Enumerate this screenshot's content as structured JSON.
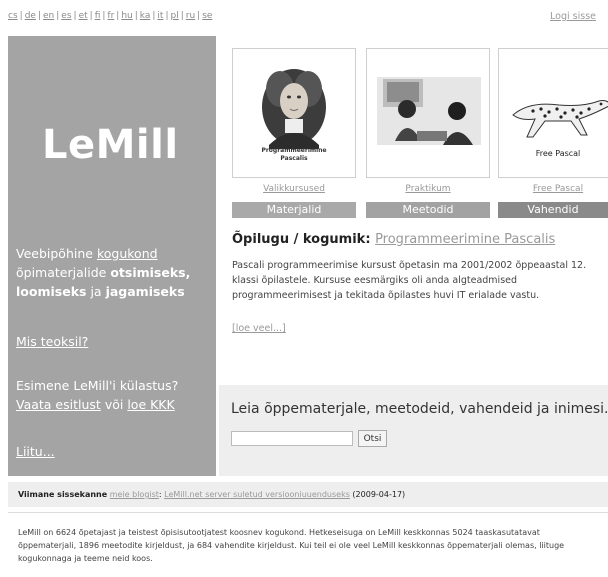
{
  "languages": [
    "cs",
    "de",
    "en",
    "es",
    "et",
    "fi",
    "fr",
    "hu",
    "ka",
    "it",
    "pl",
    "ru",
    "se"
  ],
  "login_label": "Logi sisse",
  "logo": "LeMill",
  "sidebar": {
    "intro_prefix": "Veebipõhine",
    "intro_link": "kogukond",
    "intro_mid": "õpimaterjalide",
    "intro_b1": "otsimiseks,",
    "intro_b2": "loomiseks",
    "intro_mid2": "ja",
    "intro_b3": "jagamiseks",
    "mis_teoksil": "Mis teoksil?",
    "first_visit": "Esimene LeMill'i külastus?",
    "vaata": "Vaata esitlust",
    "voi": "või",
    "loe_kkk": "loe KKK",
    "liitu": "Liitu..."
  },
  "cards": [
    {
      "img_label": "Programmeerimine Pascalis",
      "caption": "Valikkursused",
      "category": "Materjalid",
      "cat_color": "#a9a9a9"
    },
    {
      "img_label": "",
      "caption": "Praktikum",
      "category": "Meetodid",
      "cat_color": "#a2a2a2"
    },
    {
      "img_label": "Free Pascal",
      "caption": "Free Pascal",
      "category": "Vahendid",
      "cat_color": "#8a8a8a"
    }
  ],
  "feature": {
    "label": "Õpilugu / kogumik:",
    "link": "Programmeerimine Pascalis",
    "description": "Pascali programmeerimise kursust õpetasin ma 2001/2002 õppeaastal 12. klassi õpilastele. Kursuse eesmärgiks oli anda algteadmised programmeerimisest ja tekitada õpilastes huvi IT erialade vastu.",
    "more": "[loe veel...]"
  },
  "search": {
    "title": "Leia õppematerjale, meetodeid, vahendeid ja inimesi...",
    "button": "Otsi",
    "value": ""
  },
  "last_post": {
    "label": "Viimane sissekanne",
    "link1": "meie blogist",
    "link2": "LeMill.net server suletud versiooniuuenduseks",
    "date": "(2009-04-17)"
  },
  "footer": "LeMill on 6624 õpetajast ja teistest õpisisutootjatest koosnev kogukond. Hetkeseisuga on LeMill keskkonnas 5024 taaskasutatavat õppematerjali, 1896 meetodite kirjeldust, ja 684 vahendite kirjeldust. Kui teil ei ole veel LeMill keskkonnas õppematerjali olemas, liituge kogukonnaga ja teeme neid koos."
}
